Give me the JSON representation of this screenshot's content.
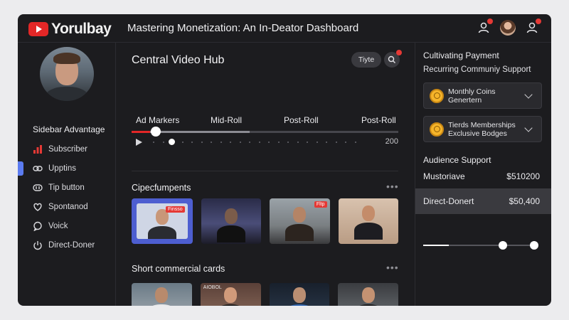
{
  "app": {
    "logo_text": "Yorulbay",
    "title": "Mastering Monetization: An In-Deator Dashboard"
  },
  "colors": {
    "accent_red": "#e32727",
    "accent_blue": "#5b7bf0",
    "panel_bg": "#1c1c1f"
  },
  "header_icons": [
    "person-alert-icon",
    "avatar",
    "person-alert-icon"
  ],
  "sidebar": {
    "title": "Sidebar Advantage",
    "items": [
      {
        "label": "Subscriber",
        "icon": "bar-chart-icon"
      },
      {
        "label": "Upptins",
        "icon": "link-icon",
        "active": true
      },
      {
        "label": "Tip button",
        "icon": "coin-stack-icon"
      },
      {
        "label": "Spontanod",
        "icon": "heart-icon"
      },
      {
        "label": "Voick",
        "icon": "chat-icon"
      },
      {
        "label": "Direct-Doner",
        "icon": "power-icon"
      }
    ]
  },
  "hub": {
    "title": "Central Video Hub",
    "pill_label": "Tiyte",
    "markers": [
      "Ad Markers",
      "Mid-Roll",
      "Post-Roll",
      "Post-Roll"
    ],
    "progress": 0.09,
    "end_value": "200",
    "components_title": "Cipecfumpents",
    "components": [
      {
        "name": "thumb-1",
        "tag": "Finsso",
        "selected": true
      },
      {
        "name": "thumb-2",
        "tag": ""
      },
      {
        "name": "thumb-3",
        "tag": "Fltp"
      },
      {
        "name": "thumb-4",
        "tag": ""
      }
    ],
    "short_title": "Short commercial cards",
    "short_cards": [
      {
        "caption": ""
      },
      {
        "caption": "AIOBOL"
      },
      {
        "caption": ""
      },
      {
        "caption": ""
      }
    ]
  },
  "right_panel": {
    "heading": "Cultivating Payment",
    "subheading": "Recurring Communiy Support",
    "cards": [
      {
        "line1": "Monthly Coins",
        "line2": "Genertern",
        "icon": "coin-icon"
      },
      {
        "line1": "Tierds Memberships",
        "line2": "Exclusive Bodges",
        "icon": "coin-icon"
      }
    ],
    "audience_title": "Audience Support",
    "rows": [
      {
        "label": "Mustoriave",
        "value": "$510200"
      },
      {
        "label": "Direct-Donert",
        "value": "$50,400",
        "highlighted": true
      }
    ],
    "slider_value": 0.72
  }
}
